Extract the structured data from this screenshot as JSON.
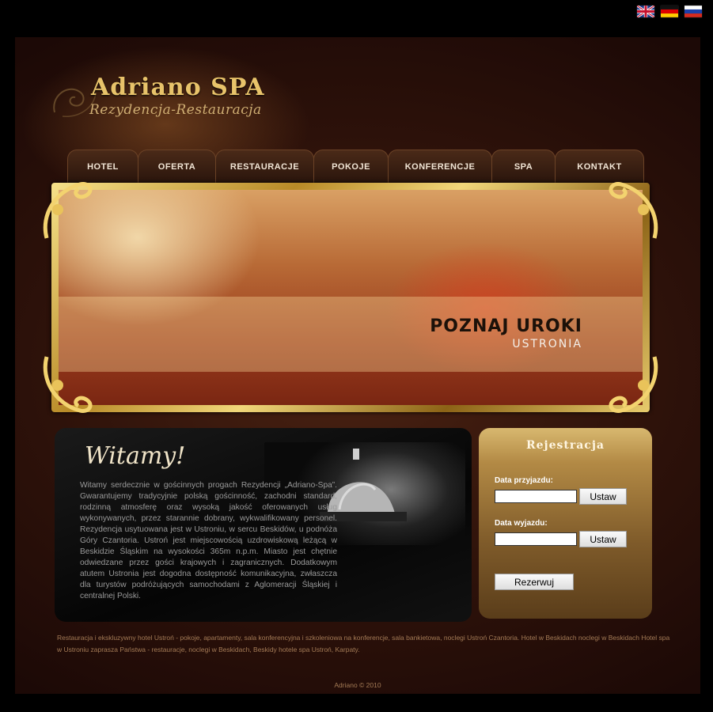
{
  "flags": [
    {
      "name": "english-flag-icon"
    },
    {
      "name": "german-flag-icon"
    },
    {
      "name": "russian-flag-icon"
    }
  ],
  "logo": {
    "title": "Adriano SPA",
    "subtitle": "Rezydencja-Restauracja"
  },
  "nav": {
    "items": [
      {
        "label": "HOTEL"
      },
      {
        "label": "OFERTA"
      },
      {
        "label": "RESTAURACJE"
      },
      {
        "label": "POKOJE"
      },
      {
        "label": "KONFERENCJE"
      },
      {
        "label": "SPA"
      },
      {
        "label": "KONTAKT"
      }
    ]
  },
  "banner": {
    "line1": "POZNAJ UROKI",
    "line2": "USTRONIA"
  },
  "welcome": {
    "title": "Witamy!",
    "text": "Witamy serdecznie w gościnnych progach Rezydencji „Adriano-Spa”. Gwarantujemy tradycyjnie polską gościnność, zachodni standard, rodzinną atmosferę oraz wysoką jakość oferowanych usług wykonywanych, przez starannie dobrany, wykwalifikowany personel. Rezydencja usytuowana jest w Ustroniu, w sercu Beskidów, u podnóża Góry Czantoria. Ustroń jest miejscowością uzdrowiskową leżącą w Beskidzie Śląskim na wysokości 365m n.p.m. Miasto jest chętnie odwiedzane przez gości krajowych i zagranicznych. Dodatkowym atutem Ustronia jest dogodna dostępność komunikacyjna, zwłaszcza dla turystów podróżujących samochodami z Aglomeracji Śląskiej i centralnej Polski."
  },
  "registration": {
    "title": "Rejestracja",
    "arrival_label": "Data przyjazdu:",
    "departure_label": "Data wyjazdu:",
    "arrival_value": "",
    "departure_value": "",
    "set_label": "Ustaw",
    "submit_label": "Rezerwuj"
  },
  "footer": {
    "text": "Restauracja i ekskluzywny hotel Ustroń - pokoje, apartamenty, sala konferencyjna i szkoleniowa na konferencje, sala bankietowa, noclegi Ustroń Czantoria. Hotel w Beskidach noclegi w Beskidach Hotel spa w Ustroniu zaprasza Państwa - restauracje, noclegi w Beskidach, Beskidy hotele spa Ustroń, Karpaty.",
    "copyright": "Adriano © 2010"
  },
  "colors": {
    "gold": "#e8c36a",
    "nav_text": "#f2e6d6",
    "footer_text": "#a47b56"
  }
}
